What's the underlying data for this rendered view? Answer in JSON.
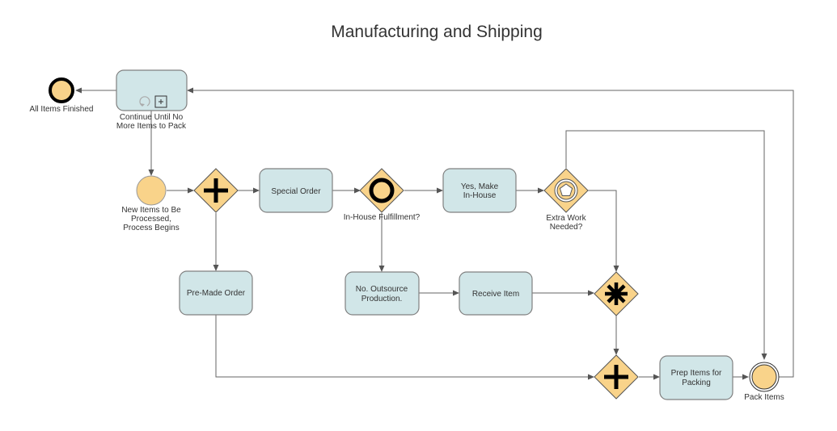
{
  "title": "Manufacturing and Shipping",
  "nodes": {
    "end_event": {
      "type": "end-event",
      "label": "All Items Finished"
    },
    "loop_subprocess": {
      "type": "looped-collapsed-subprocess",
      "label_lines": [
        "Continue Until No",
        "More Items to Pack"
      ]
    },
    "start_event": {
      "type": "start-event",
      "label_lines": [
        "New Items to Be",
        "Processed,",
        "Process Begins"
      ]
    },
    "parallel_split": {
      "type": "parallel-gateway",
      "label": ""
    },
    "special_order": {
      "type": "task",
      "label": "Special Order"
    },
    "inhouse_gateway": {
      "type": "inclusive-gateway",
      "label": "In-House Fulfillment?"
    },
    "make_inhouse": {
      "type": "task",
      "label_lines": [
        "Yes, Make",
        "In-House"
      ]
    },
    "extra_work_gateway": {
      "type": "event-based-gateway",
      "label_lines": [
        "Extra Work",
        "Needed?"
      ]
    },
    "premade_order": {
      "type": "task",
      "label": "Pre-Made Order"
    },
    "outsource": {
      "type": "task",
      "label_lines": [
        "No. Outsource",
        "Production."
      ]
    },
    "receive_item": {
      "type": "task",
      "label": "Receive Item"
    },
    "complex_gateway": {
      "type": "complex-gateway",
      "label": ""
    },
    "parallel_join": {
      "type": "parallel-gateway",
      "label": ""
    },
    "prep_items": {
      "type": "task",
      "label_lines": [
        "Prep Items for",
        "Packing"
      ]
    },
    "pack_items": {
      "type": "intermediate-event",
      "label": "Pack Items"
    }
  },
  "edges": [
    [
      "start_event",
      "parallel_split"
    ],
    [
      "parallel_split",
      "special_order"
    ],
    [
      "parallel_split",
      "premade_order"
    ],
    [
      "special_order",
      "inhouse_gateway"
    ],
    [
      "inhouse_gateway",
      "make_inhouse"
    ],
    [
      "inhouse_gateway",
      "outsource"
    ],
    [
      "make_inhouse",
      "extra_work_gateway"
    ],
    [
      "extra_work_gateway",
      "complex_gateway"
    ],
    [
      "extra_work_gateway",
      "pack_items"
    ],
    [
      "outsource",
      "receive_item"
    ],
    [
      "receive_item",
      "complex_gateway"
    ],
    [
      "complex_gateway",
      "parallel_join"
    ],
    [
      "premade_order",
      "parallel_join"
    ],
    [
      "parallel_join",
      "prep_items"
    ],
    [
      "prep_items",
      "pack_items"
    ],
    [
      "pack_items",
      "loop_subprocess"
    ],
    [
      "loop_subprocess",
      "end_event"
    ],
    [
      "loop_subprocess",
      "start_event"
    ]
  ],
  "colors": {
    "task_fill": "#d1e6e8",
    "gateway_fill": "#f9d38a",
    "event_fill": "#f9d38a",
    "edge": "#666666"
  }
}
